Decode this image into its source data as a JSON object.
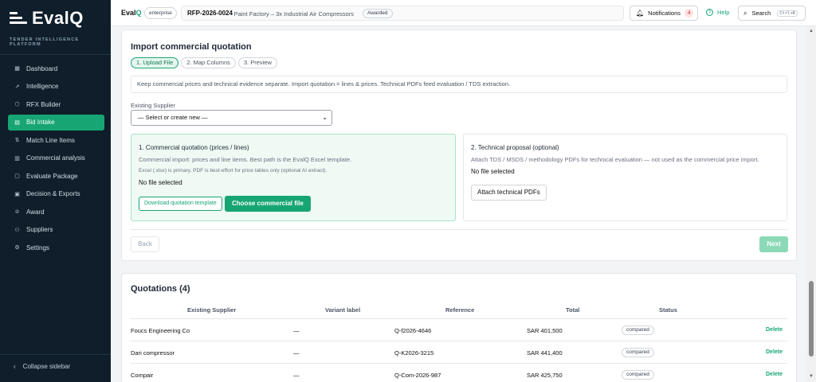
{
  "app": {
    "logo_text": "EvalQ",
    "tagline": "TENDER INTELLIGENCE PLATFORM"
  },
  "sidebar": {
    "items": [
      {
        "label": "Dashboard",
        "icon": "dashboard-icon",
        "glyph": "▦"
      },
      {
        "label": "Intelligence",
        "icon": "trend-chart-icon",
        "glyph": "↗"
      },
      {
        "label": "RFX Builder",
        "icon": "box-icon",
        "glyph": "⬡"
      },
      {
        "label": "Bid Intake",
        "icon": "document-icon",
        "glyph": "▤",
        "active": true
      },
      {
        "label": "Match Line Items",
        "icon": "swap-arrows-icon",
        "glyph": "⇅"
      },
      {
        "label": "Commercial analysis",
        "icon": "bar-chart-icon",
        "glyph": "▥"
      },
      {
        "label": "Evaluate Package",
        "icon": "clipboard-icon",
        "glyph": "▢"
      },
      {
        "label": "Decision & Exports",
        "icon": "file-export-icon",
        "glyph": "▣"
      },
      {
        "label": "Award",
        "icon": "award-icon",
        "glyph": "♔"
      },
      {
        "label": "Suppliers",
        "icon": "users-icon",
        "glyph": "⚇"
      },
      {
        "label": "Settings",
        "icon": "gear-icon",
        "glyph": "⚙"
      }
    ],
    "collapse_label": "Collapse sidebar"
  },
  "topbar": {
    "brand": "EvalQ",
    "env": "enterprise",
    "rfp_id": "RFP-2026-0024",
    "rfp_title": "· Paint Factory – 3x Industrial Air Compressors",
    "rfp_status": "Awarded",
    "notifications_label": "Notifications",
    "notifications_count": "4",
    "help_label": "Help",
    "search_label": "Search",
    "search_shortcut": "Ctrl+K"
  },
  "import": {
    "title": "Import commercial quotation",
    "steps": [
      "1. Upload File",
      "2. Map Columns",
      "3. Preview"
    ],
    "info": "Keep commercial prices and technical evidence separate. Import quotation = lines & prices. Technical PDFs feed evaluation / TDS extraction.",
    "supplier_label": "Existing Supplier",
    "supplier_value": "— Select or create new —",
    "commercial": {
      "title": "1. Commercial quotation (prices / lines)",
      "desc": "Commercial import: prices and line items. Best path is the EvalQ Excel template.",
      "note": "Excel (.xlsx) is primary. PDF is best-effort for price tables only (optional AI extract).",
      "file_status": "No file selected",
      "download_label": "Download quotation template",
      "choose_label": "Choose commercial file"
    },
    "technical": {
      "title": "2. Technical proposal (optional)",
      "desc": "Attach TDS / MSDS / methodology PDFs for technical evaluation — not used as the commercial price import.",
      "file_status": "No file selected",
      "attach_label": "Attach technical PDFs"
    },
    "back_label": "Back",
    "next_label": "Next"
  },
  "quotations": {
    "title": "Quotations (4)",
    "columns": [
      "Existing Supplier",
      "Variant label",
      "Reference",
      "Total",
      "Status"
    ],
    "rows": [
      {
        "supplier": "Foucs Engineering Co",
        "variant": "—",
        "reference": "Q-f2026-4646",
        "total": "SAR 401,500",
        "status": "compared",
        "action": "Delete"
      },
      {
        "supplier": "Dari compressor",
        "variant": "—",
        "reference": "Q-K2026-3215",
        "total": "SAR 441,400",
        "status": "compared",
        "action": "Delete"
      },
      {
        "supplier": "Compair",
        "variant": "—",
        "reference": "Q-Com-2026-987",
        "total": "SAR 425,750",
        "status": "compared",
        "action": "Delete"
      }
    ]
  },
  "colors": {
    "accent": "#17a673",
    "sidebar_bg": "#0f1e2a"
  }
}
